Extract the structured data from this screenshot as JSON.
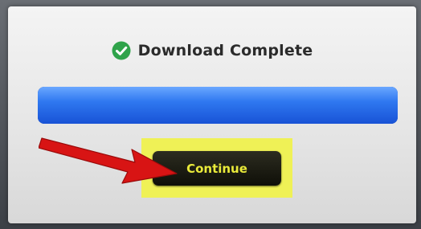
{
  "dialog": {
    "title": "Download Complete",
    "status_icon": "check-circle-icon",
    "progress": 1.0,
    "continue_label": "Continue"
  },
  "annotation": {
    "arrow_icon": "red-arrow-icon",
    "highlight_color": "#f0f24a"
  },
  "colors": {
    "check_green": "#2fa34a",
    "progress_blue": "#2f78f0",
    "button_text": "#e9ea3a"
  }
}
